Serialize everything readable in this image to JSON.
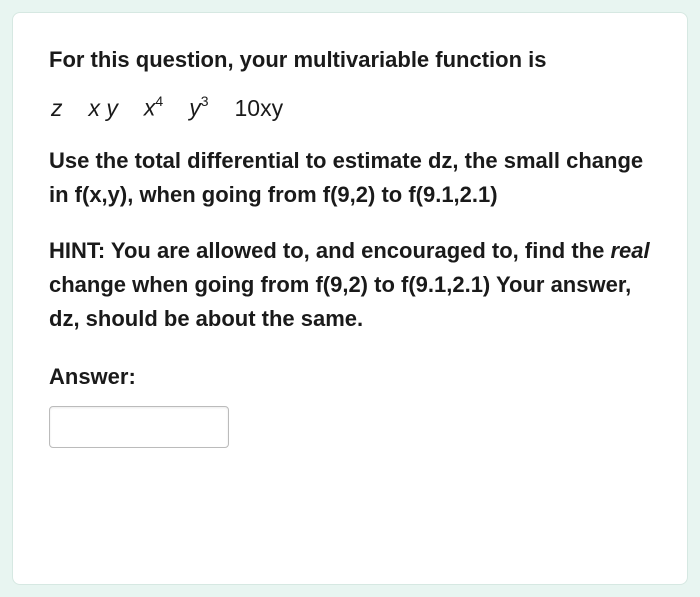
{
  "question": {
    "intro": "For this question, your multivariable function is",
    "equation_parts": {
      "z": "z",
      "xy": "x y",
      "x_base": "x",
      "x_exp": "4",
      "y_base": "y",
      "y_exp": "3",
      "tenxy": "10xy"
    },
    "body": "Use the total differential to estimate dz, the small change in f(x,y), when going from f(9,2) to f(9.1,2.1)",
    "hint_prefix": "HINT: You are allowed to, and encouraged to, find the ",
    "hint_real": "real",
    "hint_suffix": " change when going from f(9,2) to f(9.1,2.1) Your answer, dz, should be about the same.",
    "answer_label": "Answer:",
    "answer_value": ""
  }
}
